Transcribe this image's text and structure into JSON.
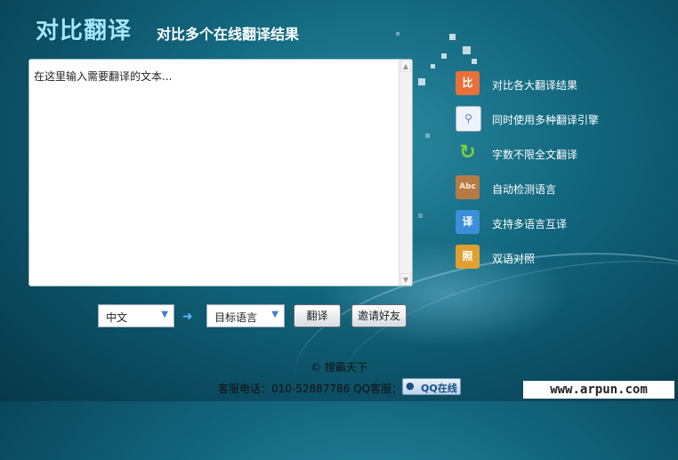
{
  "header": {
    "logo": "对比翻译",
    "subtitle": "对比多个在线翻译结果"
  },
  "input": {
    "placeholder": "在这里输入需要翻译的文本..."
  },
  "features": [
    {
      "label": "对比各大翻译结果",
      "icon": "compare-icon",
      "color": "#e8703a"
    },
    {
      "label": "同时使用多种翻译引擎",
      "icon": "magnifier-document-icon",
      "color": "#5a7fbf"
    },
    {
      "label": "字数不限全文翻译",
      "icon": "refresh-arrow-icon",
      "color": "#6abf2a"
    },
    {
      "label": "自动检测语言",
      "icon": "abc-book-icon",
      "color": "#b57b45"
    },
    {
      "label": "支持多语言互译",
      "icon": "translate-calendar-icon",
      "color": "#3a8fd8"
    },
    {
      "label": "双语对照",
      "icon": "bilingual-contrast-icon",
      "color": "#e0a030"
    }
  ],
  "controls": {
    "source_lang": "中文",
    "target_lang": "目标语言",
    "translate_button": "翻译",
    "invite_button": "邀请好友"
  },
  "footer": {
    "copyright": "© 搜霸天下",
    "contact": "客服电话：010-52887786   QQ客服：",
    "qq_button": "QQ在线",
    "watermark": "www.arpun.com"
  }
}
